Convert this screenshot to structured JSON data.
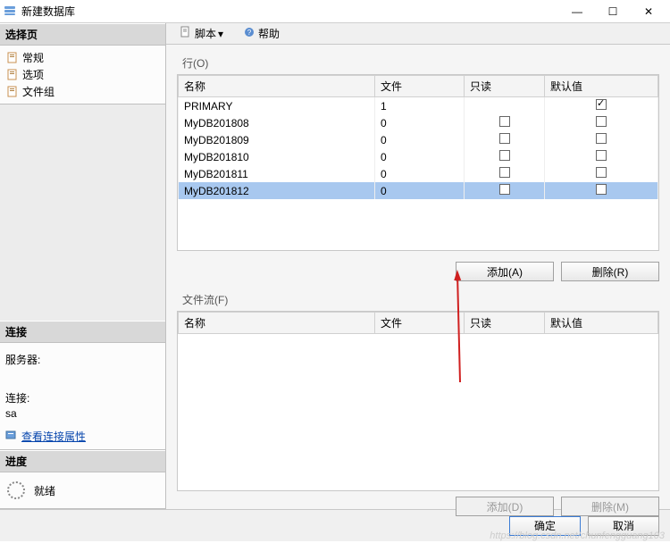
{
  "window": {
    "title": "新建数据库",
    "min": "—",
    "max": "☐",
    "close": "✕"
  },
  "sidebar": {
    "select_page": {
      "header": "选择页",
      "items": [
        "常规",
        "选项",
        "文件组"
      ]
    },
    "connection": {
      "header": "连接",
      "server_label": "服务器:",
      "server_value": "",
      "conn_label": "连接:",
      "conn_value": "sa",
      "view_props": "查看连接属性"
    },
    "progress": {
      "header": "进度",
      "status": "就绪"
    }
  },
  "toolbar": {
    "script": "脚本",
    "help": "帮助"
  },
  "upper": {
    "label": "行(O)",
    "cols": {
      "name": "名称",
      "file": "文件",
      "readonly": "只读",
      "default": "默认值"
    },
    "rows": [
      {
        "name": "PRIMARY",
        "file": "1",
        "readonly": null,
        "default_checked": true,
        "selected": false
      },
      {
        "name": "MyDB201808",
        "file": "0",
        "readonly": false,
        "default_checked": false,
        "selected": false
      },
      {
        "name": "MyDB201809",
        "file": "0",
        "readonly": false,
        "default_checked": false,
        "selected": false
      },
      {
        "name": "MyDB201810",
        "file": "0",
        "readonly": false,
        "default_checked": false,
        "selected": false
      },
      {
        "name": "MyDB201811",
        "file": "0",
        "readonly": false,
        "default_checked": false,
        "selected": false
      },
      {
        "name": "MyDB201812",
        "file": "0",
        "readonly": false,
        "default_checked": false,
        "selected": true
      }
    ],
    "add": "添加(A)",
    "remove": "删除(R)"
  },
  "lower": {
    "label": "文件流(F)",
    "cols": {
      "name": "名称",
      "file": "文件",
      "readonly": "只读",
      "default": "默认值"
    },
    "rows": [],
    "add": "添加(D)",
    "remove": "删除(M)"
  },
  "footer": {
    "ok": "确定",
    "cancel": "取消"
  },
  "watermark": "https://blog.csdn.net/chunfengguang103"
}
